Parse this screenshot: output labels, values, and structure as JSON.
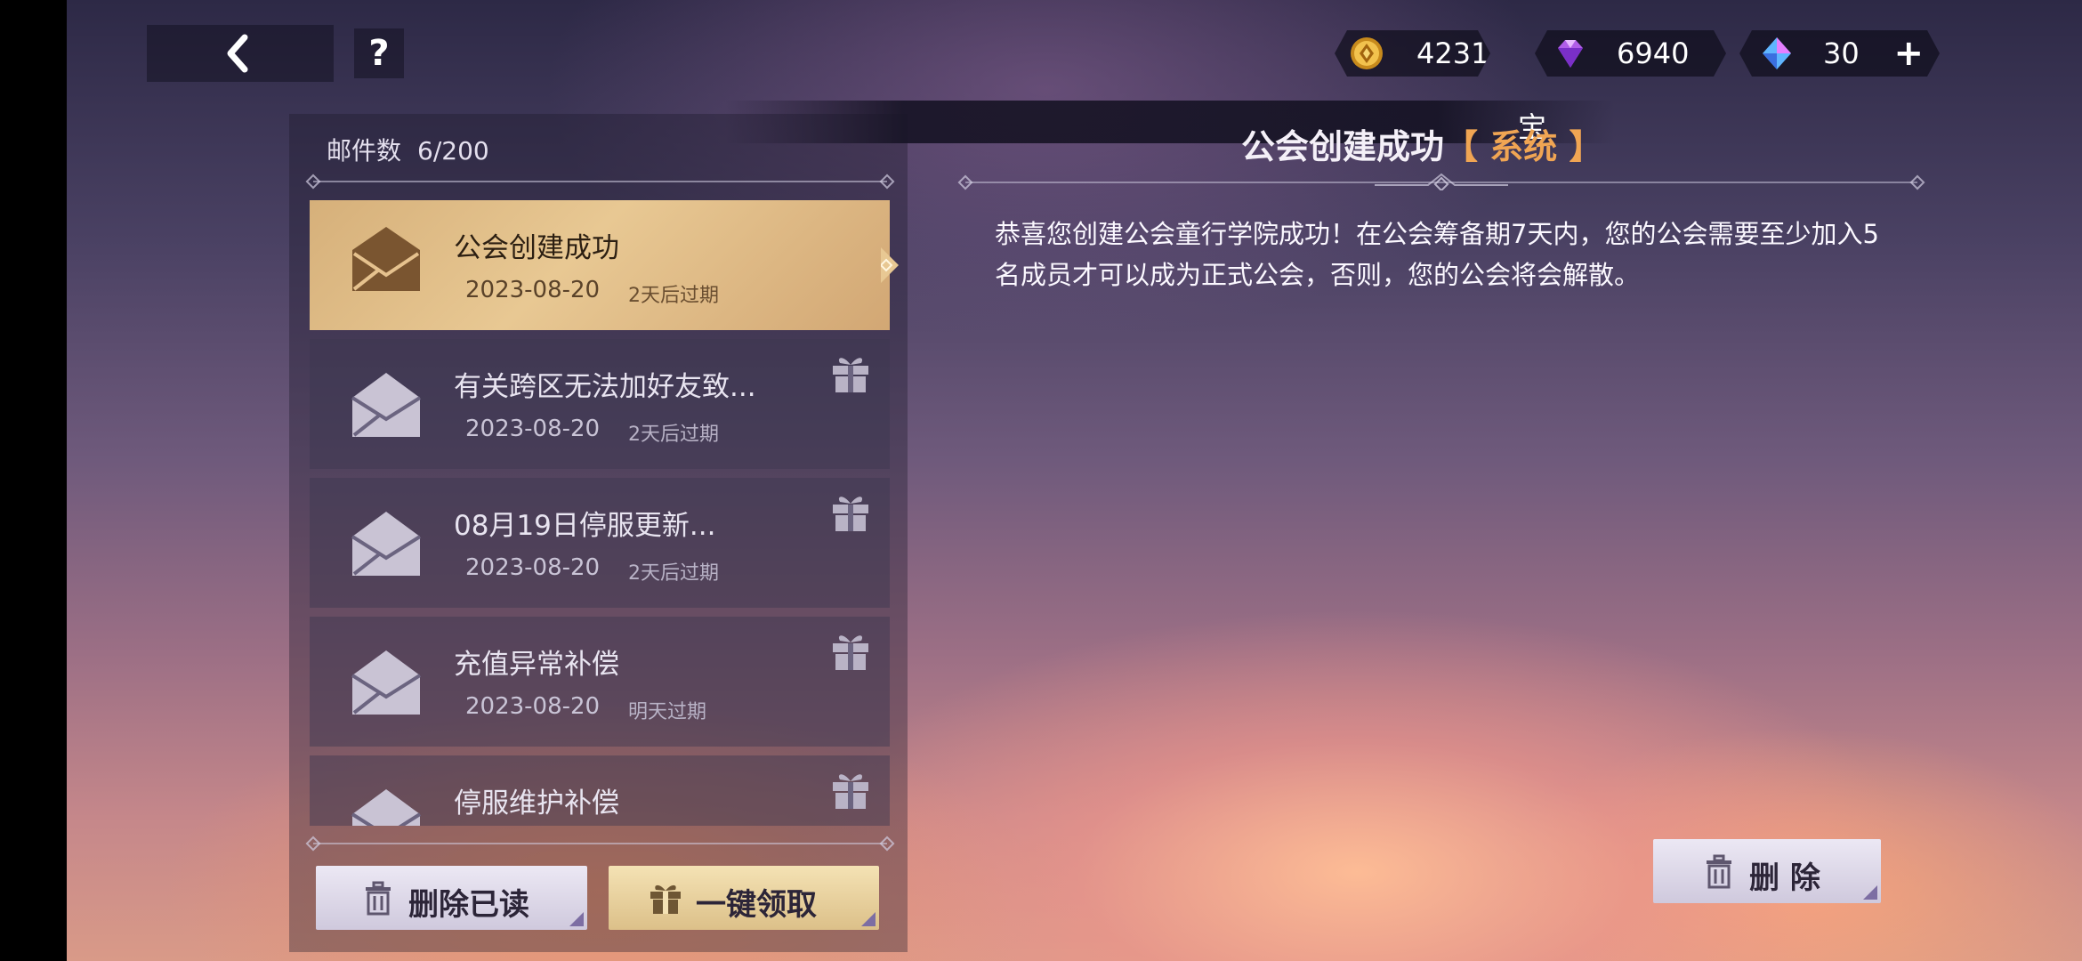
{
  "header": {
    "help_label": "?",
    "currencies": [
      {
        "name": "gold-coin",
        "value": "4231"
      },
      {
        "name": "purple-diamond",
        "value": "6940"
      },
      {
        "name": "blue-crystal",
        "value": "30",
        "add_label": "+"
      }
    ],
    "banner_text": "宝"
  },
  "mailbox": {
    "count_label": "邮件数",
    "count_value": "6/200",
    "items": [
      {
        "title": "公会创建成功",
        "date": "2023-08-20",
        "expire": "2天后过期",
        "selected": true,
        "has_gift": false
      },
      {
        "title": "有关跨区无法加好友致...",
        "date": "2023-08-20",
        "expire": "2天后过期",
        "selected": false,
        "has_gift": true
      },
      {
        "title": "08月19日停服更新...",
        "date": "2023-08-20",
        "expire": "2天后过期",
        "selected": false,
        "has_gift": true
      },
      {
        "title": "充值异常补偿",
        "date": "2023-08-20",
        "expire": "明天过期",
        "selected": false,
        "has_gift": true
      },
      {
        "title": "停服维护补偿",
        "date": "",
        "expire": "",
        "selected": false,
        "has_gift": true
      }
    ],
    "delete_read_label": "删除已读",
    "claim_all_label": "一键领取"
  },
  "detail": {
    "title": "公会创建成功",
    "tag": "【 系统 】",
    "body": "恭喜您创建公会童行学院成功！在公会筹备期7天内，您的公会需要至少加入5名成员才可以成为正式公会，否则，您的公会将会解散。",
    "delete_label": "删 除"
  },
  "colors": {
    "selected_gold": "#e8c893",
    "tag_orange": "#f0a553",
    "claim_button": "#f4e2b4",
    "button_light": "#ece8f4"
  }
}
